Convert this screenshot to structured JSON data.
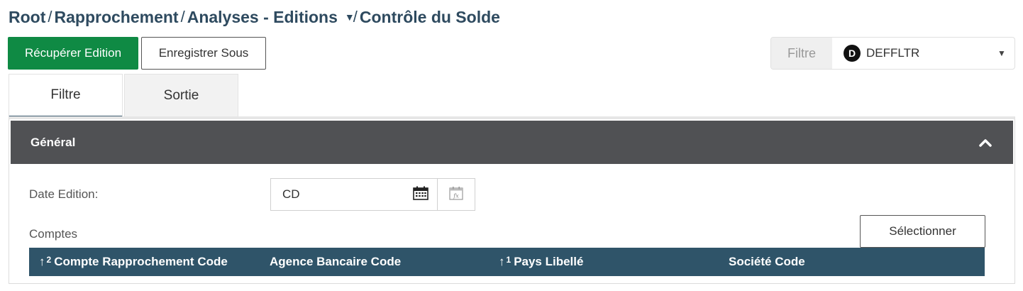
{
  "breadcrumb": {
    "items": [
      "Root",
      "Rapprochement",
      "Analyses - Editions",
      "Contrôle du Solde"
    ],
    "separator": "/"
  },
  "toolbar": {
    "recover_label": "Récupérer Edition",
    "save_as_label": "Enregistrer Sous"
  },
  "filter": {
    "label": "Filtre",
    "badge": "D",
    "value": "DEFFLTR"
  },
  "tabs": [
    {
      "label": "Filtre",
      "active": true
    },
    {
      "label": "Sortie",
      "active": false
    }
  ],
  "section": {
    "title": "Général"
  },
  "form": {
    "date_label": "Date Edition:",
    "date_value": "CD",
    "accounts_label": "Comptes",
    "select_label": "Sélectionner"
  },
  "table": {
    "columns": [
      {
        "label": "Compte Rapprochement Code",
        "sort_order": "2"
      },
      {
        "label": "Agence Bancaire Code",
        "sort_order": ""
      },
      {
        "label": "Pays Libellé",
        "sort_order": "1"
      },
      {
        "label": "Société Code",
        "sort_order": ""
      }
    ]
  },
  "colors": {
    "primary": "#0f8a44",
    "breadcrumb": "#2e4a5f",
    "section_header": "#505154",
    "table_header": "#2f5469"
  }
}
